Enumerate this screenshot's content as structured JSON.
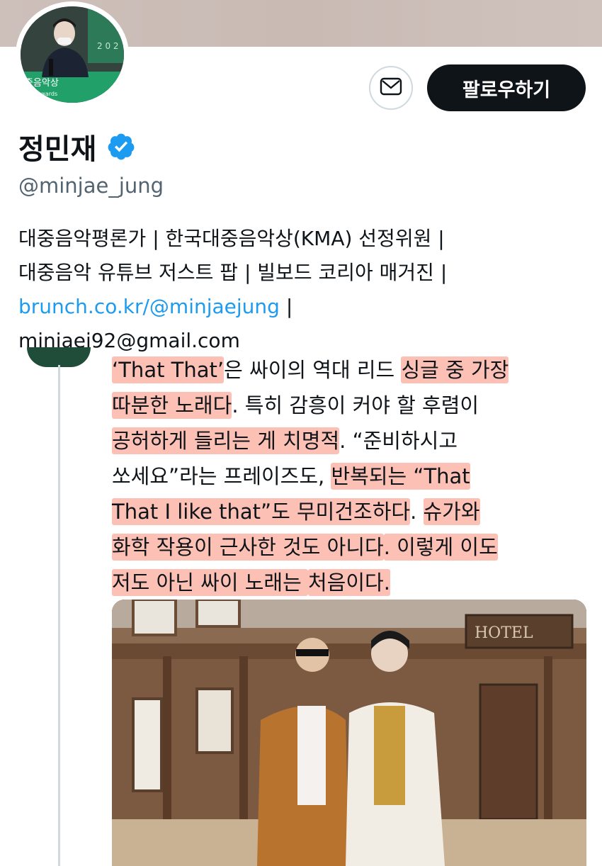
{
  "profile": {
    "name": "정민재",
    "handle": "@minjae_jung",
    "follow_label": "팔로우하기",
    "bio_line1": "대중음악평론가 | 한국대중음악상(KMA) 선정위원 |",
    "bio_line2": "대중음악 유튜브 저스트 팝 | 빌보드 코리아 매거진 |",
    "bio_link": "brunch.co.kr/@minjaejung",
    "bio_link_suffix": " |",
    "bio_email": "minjaej92@gmail.com"
  },
  "icons": {
    "message": "envelope-icon",
    "verified": "verified-badge-icon"
  },
  "colors": {
    "link": "#1d9bf0",
    "verified": "#1d9bf0",
    "highlight": "#fa8c78",
    "follow_bg": "#0f1419"
  },
  "tweet": {
    "l1a": "‘That That’",
    "l1b": "은 싸이의 역대 리드 ",
    "l1c": "싱글 중 가장",
    "l2a": "따분한 노래다",
    "l2b": ". 특히 감흥이 커야 할 후렴이",
    "l3a": "공허하게 들리는 게 치명적",
    "l3b": ". “준비하시고",
    "l4a": "쏘세요”라는 프레이즈도, ",
    "l4b": "반복되는 “That",
    "l5a": "That I like that”도 무미건조하다",
    "l5b": ". ",
    "l5c": "슈가와",
    "l6a": "화학 작용이 근사한 것도 아니다",
    "l6b": ". 이렇게 이도",
    "l7a": "저도 아닌 싸이 노래는 ",
    "l7b": "처음이다."
  },
  "photo_sign": {
    "hotel": "HOTEL"
  },
  "avatar_text": {
    "sign_ko": "중음악상",
    "sign_en": "ic Awards",
    "year": "2 0 2"
  }
}
